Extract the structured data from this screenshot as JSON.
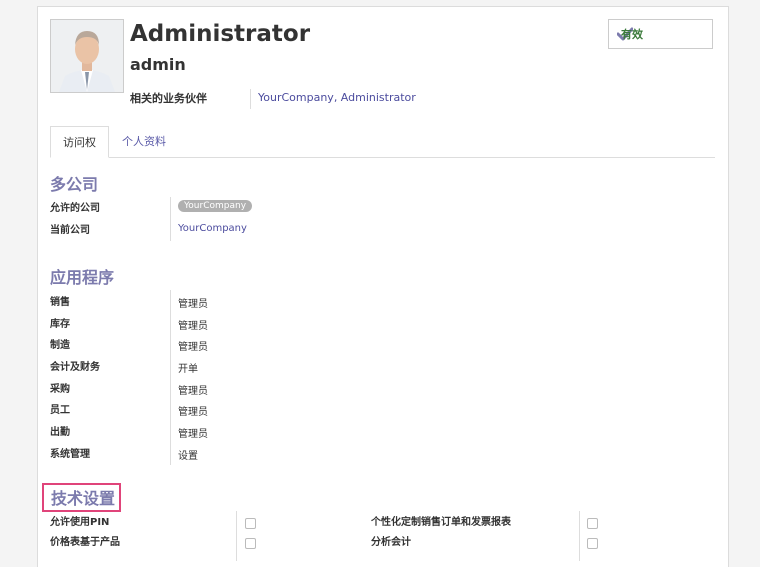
{
  "user": {
    "name": "Administrator",
    "login": "admin",
    "partner_label": "相关的业务伙伴",
    "partner_value": "YourCompany, Administrator",
    "status": "有效"
  },
  "tabs": [
    {
      "label": "访问权"
    },
    {
      "label": "个人资料"
    }
  ],
  "multi_company": {
    "title": "多公司",
    "allowed_label": "允许的公司",
    "allowed_tag": "YourCompany",
    "current_label": "当前公司",
    "current_value": "YourCompany"
  },
  "applications": {
    "title": "应用程序",
    "rows": [
      {
        "label": "销售",
        "value": "管理员"
      },
      {
        "label": "库存",
        "value": "管理员"
      },
      {
        "label": "制造",
        "value": "管理员"
      },
      {
        "label": "会计及财务",
        "value": "开单"
      },
      {
        "label": "采购",
        "value": "管理员"
      },
      {
        "label": "员工",
        "value": "管理员"
      },
      {
        "label": "出勤",
        "value": "管理员"
      },
      {
        "label": "系统管理",
        "value": "设置"
      }
    ]
  },
  "technical": {
    "title": "技术设置",
    "left": [
      {
        "label": "允许使用PIN"
      },
      {
        "label": "价格表基于产品"
      }
    ],
    "right": [
      {
        "label": "个性化定制销售订单和发票报表"
      },
      {
        "label": "分析会计"
      }
    ]
  }
}
